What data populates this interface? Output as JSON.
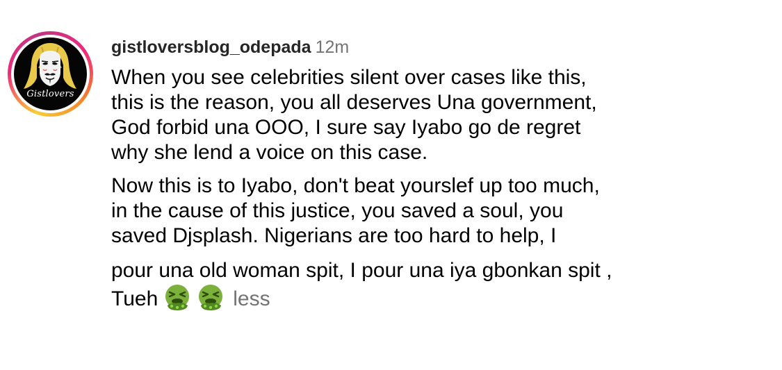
{
  "comment": {
    "username": "gistloversblog_odepada",
    "time": "12m",
    "avatar_text": "Gistlovers",
    "paragraphs": [
      {
        "lines": [
          "When you see celebrities silent over cases like this,",
          "this is the reason, you all deserves Una government,",
          "God forbid una OOO, I sure say Iyabo go de regret",
          "why she lend a voice on this case."
        ]
      },
      {
        "lines": [
          "Now this is to Iyabo, don't beat yourslef up too much,",
          "in the cause of this justice, you saved a soul, you",
          "saved Djsplash. Nigerians are too hard to help, I"
        ]
      }
    ],
    "last_paragraph": {
      "line1": "pour una old woman spit, I pour una iya gbonkan spit ,",
      "line2": "Tueh"
    },
    "emojis": [
      "vomiting-face",
      "vomiting-face"
    ],
    "less_label": "less"
  },
  "colors": {
    "text": "#000000",
    "muted": "#737373",
    "ring_start": "#f9ce34",
    "ring_mid": "#ee2a7b",
    "ring_end": "#c13584",
    "emoji_face": "#7bb03a",
    "emoji_vomit": "#4e8a1e"
  }
}
